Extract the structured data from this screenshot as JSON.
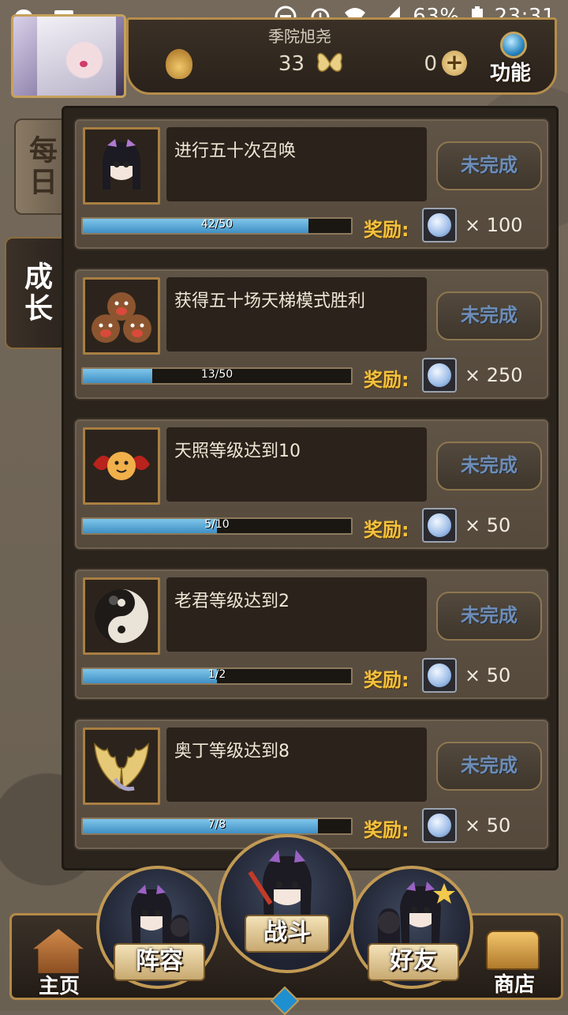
{
  "status_bar": {
    "battery": "63%",
    "time": "23:31"
  },
  "header": {
    "player_name": "季院旭尧",
    "currency_1": "33",
    "currency_2": "0",
    "plus_symbol": "+",
    "function_label": "功能"
  },
  "tabs": [
    {
      "label": "每日",
      "active": false
    },
    {
      "label": "成长",
      "active": true
    }
  ],
  "quests": [
    {
      "title": "进行五十次召唤",
      "status": "未完成",
      "progress_text": "42/50",
      "progress": 0.84,
      "reward_label": "奖励:",
      "reward_amount": "× 100",
      "icon": "chibi-girl-icon"
    },
    {
      "title": "获得五十场天梯模式胜利",
      "status": "未完成",
      "progress_text": "13/50",
      "progress": 0.26,
      "reward_label": "奖励:",
      "reward_amount": "× 250",
      "icon": "bears-icon"
    },
    {
      "title": "天照等级达到10",
      "status": "未完成",
      "progress_text": "5/10",
      "progress": 0.5,
      "reward_label": "奖励:",
      "reward_amount": "× 50",
      "icon": "sun-creature-icon"
    },
    {
      "title": "老君等级达到2",
      "status": "未完成",
      "progress_text": "1/2",
      "progress": 0.5,
      "reward_label": "奖励:",
      "reward_amount": "× 50",
      "icon": "yin-yang-icon"
    },
    {
      "title": "奥丁等级达到8",
      "status": "未完成",
      "progress_text": "7/8",
      "progress": 0.875,
      "reward_label": "奖励:",
      "reward_amount": "× 50",
      "icon": "wings-icon"
    }
  ],
  "bottom_nav": {
    "home": "主页",
    "team": "阵容",
    "battle": "战斗",
    "friends": "好友",
    "shop": "商店"
  },
  "colors": {
    "progress_fill": "#5aa8d8",
    "reward_label": "#f4c23b",
    "frame_gold": "#b58d4b"
  }
}
